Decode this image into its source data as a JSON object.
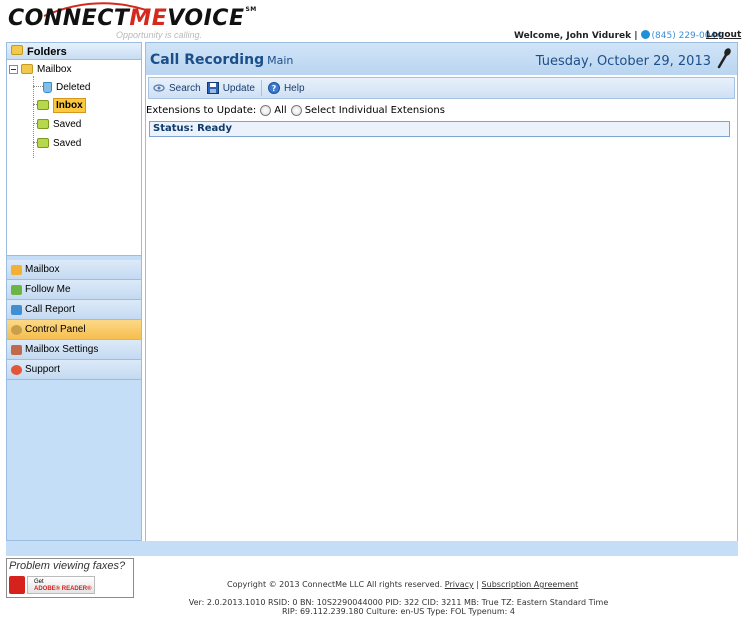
{
  "header": {
    "logo_connect": "CONNECT",
    "logo_me": "ME",
    "logo_voice": "VOICE",
    "logo_sm": "SM",
    "tagline": "Opportunity is calling.",
    "welcome": "Welcome, John Vidurek |",
    "phone": "(845) 229-0044",
    "logout": "Logout"
  },
  "sidebar": {
    "folders_title": "Folders",
    "tree": {
      "root": "Mailbox",
      "children": [
        "Deleted",
        "Inbox",
        "Saved",
        "Saved"
      ]
    },
    "nav": [
      {
        "label": "Mailbox",
        "icon": "mailbox-icon"
      },
      {
        "label": "Follow Me",
        "icon": "follow-me-icon"
      },
      {
        "label": "Call Report",
        "icon": "call-report-icon"
      },
      {
        "label": "Control Panel",
        "icon": "control-panel-icon",
        "active": true
      },
      {
        "label": "Mailbox Settings",
        "icon": "mailbox-settings-icon"
      },
      {
        "label": "Support",
        "icon": "support-icon"
      }
    ]
  },
  "main": {
    "title": "Call Recording",
    "subtitle": "Main",
    "date": "Tuesday, October 29, 2013",
    "toolbar": {
      "search": "Search",
      "update": "Update",
      "help": "Help"
    },
    "extensions_label": "Extensions to Update:",
    "option_all": "All",
    "option_individual": "Select Individual Extensions",
    "status": "Status: Ready"
  },
  "footer": {
    "adobe_prompt": "Problem viewing faxes?",
    "adobe_get": "Get",
    "adobe_reader": "ADOBE® READER®",
    "copyright": "Copyright © 2013 ConnectMe LLC All rights reserved.",
    "privacy": "Privacy",
    "subscription": "Subscription Agreement",
    "version_line1": "Ver: 2.0.2013.1010   RSID: 0 BN: 10S2290044000 PID: 322 CID: 3211 MB: True   TZ: Eastern Standard Time",
    "version_line2": "RIP: 69.112.239.180 Culture: en-US Type: FOL Typenum: 4"
  },
  "colors": {
    "brand_red": "#d42a1e",
    "panel_blue": "#c5def7",
    "title_blue": "#1c4f8a",
    "active_orange": "#f6be4e"
  }
}
